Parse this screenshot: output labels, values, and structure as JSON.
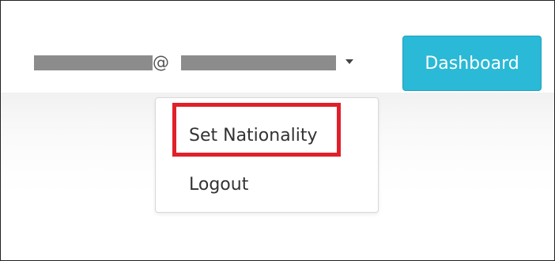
{
  "navbar": {
    "user_menu": {
      "at_symbol": "@",
      "caret_icon": "caret-down-icon"
    },
    "dashboard_button": {
      "label": "Dashboard"
    }
  },
  "dropdown": {
    "items": [
      {
        "label": "Set Nationality",
        "highlighted": true
      },
      {
        "label": "Logout",
        "highlighted": false
      }
    ]
  },
  "colors": {
    "dashboard_button_bg": "#2ab9d6",
    "highlight_border": "#e0202a",
    "redaction": "#8c8c8c"
  }
}
